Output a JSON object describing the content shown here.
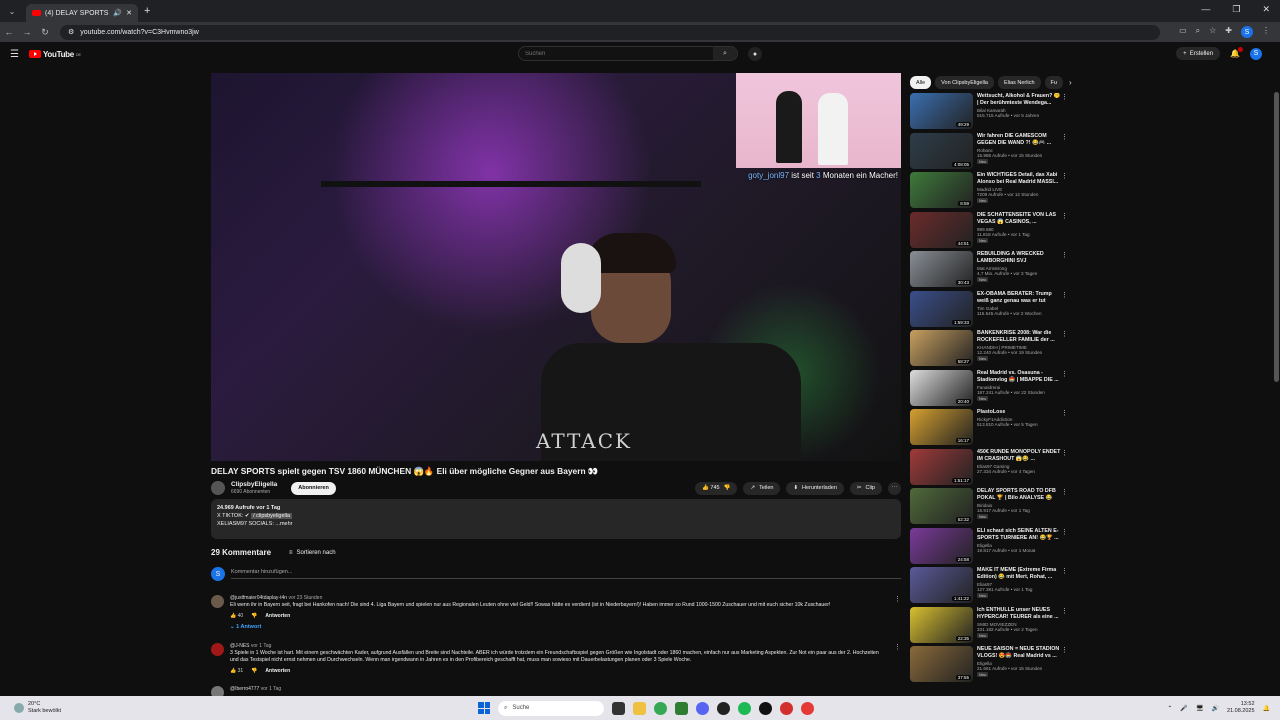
{
  "browser": {
    "tab_title": "(4) DELAY SPORTS spielt ge",
    "url": "youtube.com/watch?v=C3Hvmwno3jw",
    "profile_initial": "S"
  },
  "youtube": {
    "logo_text": "YouTube",
    "logo_country": "DE",
    "search_placeholder": "Suchen",
    "create_label": "Erstellen"
  },
  "video": {
    "pip_username": "goty_jonl97",
    "pip_message_pre": "ist seit",
    "pip_months": "3",
    "pip_message_post": "Monaten ein Macher!",
    "shirt_text": "ATTACK",
    "title": "DELAY SPORTS spielt gegen TSV 1860 MÜNCHEN 😱🔥 Eli über mögliche Gegner aus Bayern 👀",
    "channel_name": "ClipsbyEligella",
    "channel_subs": "6690 Abonnenten",
    "subscribe_label": "Abonnieren",
    "likes": "745",
    "share_label": "Teilen",
    "download_label": "Herunterladen",
    "clip_label": "Clip"
  },
  "description": {
    "stats": "24.969 Aufrufe  vor 1 Tag",
    "line1_prefix": "X TIKTOK: ✔",
    "line1_handle": "/ clipsbyeligella",
    "line2": "XELIASM97 SOCIALS:  ...mehr"
  },
  "comments": {
    "count": "29 Kommentare",
    "sort_label": "Sortieren nach",
    "add_placeholder": "Kommentar hinzufügen...",
    "user_initial": "S",
    "items": [
      {
        "author": "@justfmaier04tdaplay-t4n",
        "time": "vor 23 Stunden",
        "text": "Eli wenn ihr in Bayern seit, fragt bei Hankofen nach! Die sind 4. Liga Bayern und spielen nur aus Regionalen Leuten ohne viel Geld!! Sowas hätte es verdient (ist in Niederbayern!)! Haben immer so Rund 1000-1500 Zuschauer und mit euch sicher 10k Zuschauer!",
        "likes": "40",
        "reply_label": "Antworten",
        "replies": "1 Antwort"
      },
      {
        "author": "@J-NES",
        "time": "vor 1 Tag",
        "text": "3 Spiele in 1 Woche ist hart. Mit einem geschwächten Kader, aufgrund Ausfällen und Breite sind Nachteile. ABER ich würde trotzdem ein Freundschaftsspiel gegen Größen wie Ingolstadt oder 1860 machen, einfach nur aus Marketing Aspekten. Zur Not ein paar aus der 2. Hochzeiten und das Testspiel nicht ernst nehmen und Durchwechseln. Wenn man irgendwann in Jahren es in den Profibereich geschafft hat, muss man sowieso mit Dauerbelastungen planen oder 3 Spiele Woche.",
        "likes": "31",
        "reply_label": "Antworten"
      },
      {
        "author": "@Iberro4777",
        "time": "vor 1 Tag"
      }
    ]
  },
  "sidebar": {
    "chips": [
      "Alle",
      "Von ClipsbyEligella",
      "Elias Nerlich",
      "Fu"
    ],
    "recommendations": [
      {
        "title": "Wettsucht, Alkohol & Frauen? 🤫 | Der berühmteste Wendega...",
        "channel": "Bilal Kamarah",
        "meta": "515.715 Aufrufe • vor 5 Jahren",
        "duration": "49:29",
        "color": "#3a6fb0"
      },
      {
        "title": "Wir fahren DIE GAMESCOM GEGEN DIE WAND ?! 😂🎮 ...",
        "channel": "Rohanc",
        "meta": "15.986 Aufrufe • vor 15 Stunden",
        "duration": "4:08:05",
        "color": "#2d3d4a",
        "new": "Neu"
      },
      {
        "title": "Ein WICHTIGES Detail, das Xabi Alonso bei Real Madrid MASSI...",
        "channel": "Madrid LIVE",
        "meta": "7209 Aufrufe • vor 12 Stunden",
        "duration": "8:59",
        "color": "#3e7a3a",
        "new": "Neu"
      },
      {
        "title": "DIE SCHATTENSEITE VON LAS VEGAS 😱 CASINOS, ...",
        "channel": "999.580",
        "meta": "11.818 Aufrufe • vor 1 Tag",
        "duration": "44:51",
        "color": "#6b2b2b",
        "new": "Neu"
      },
      {
        "title": "REBUILDING A WRECKED LAMBORGHINI SVJ",
        "channel": "Mat Armstrong",
        "meta": "4,7 Mio. Aufrufe • vor 3 Tagen",
        "duration": "30:43",
        "color": "#8a8f96",
        "new": "Neu"
      },
      {
        "title": "EX-OBAMA BERATER: Trump weiß ganz genau was er tut",
        "channel": "Tim Gabel",
        "meta": "115.545 Aufrufe • vor 2 Wochen",
        "duration": "1:59:33",
        "color": "#3a4f8a"
      },
      {
        "title": "BANKENKRISE 2008: War die ROCKEFELLER FAMILIE der ...",
        "channel": "KHANDIH | PRIMETIME",
        "meta": "12.240 Aufrufe • vor 19 Stunden",
        "duration": "58:27",
        "color": "#c8a060",
        "new": "Neu"
      },
      {
        "title": "Real Madrid vs. Osasuna - Stadionvlog 🏟️ | MBAPPE DIE ...",
        "channel": "Fanaldrerai",
        "meta": "187.241 Aufrufe • vor 22 Stunden",
        "duration": "20:40",
        "color": "#ddd",
        "new": "Neu"
      },
      {
        "title": "PlastoLose",
        "channel": "RickyF1Addiction",
        "meta": "513.810 Aufrufe • vor 5 Tagen",
        "duration": "16:17",
        "color": "#d6a030"
      },
      {
        "title": "450€ RUNDE MONOPOLY ENDET IM CRASHOUT 😱😂 ...",
        "channel": "Elias97 Gaming",
        "meta": "27.334 Aufrufe • vor 4 Tagen",
        "duration": "1:51:17",
        "color": "#a03a3a"
      },
      {
        "title": "DELAY SPORTS ROAD TO DFB POKAL 🏆 | Bilo ANALYSE 😂",
        "channel": "Biridaio",
        "meta": "16.917 Aufrufe • vor 1 Tag",
        "duration": "52:32",
        "color": "#4f6a3a",
        "new": "Neu"
      },
      {
        "title": "ELI schaut sich SEINE ALTEN E-SPORTS TURNIERE AN! 😂🏆 ...",
        "channel": "Eligella",
        "meta": "19.817 Aufrufe • vor 1 Monat",
        "duration": "24:58",
        "color": "#7a3a9a"
      },
      {
        "title": "MAKE IT MEME (Extreme Firma Edition) 😂 mit Mert, Rohat, ...",
        "channel": "Elias97",
        "meta": "127.381 Aufrufe • vor 1 Tag",
        "duration": "1:41:22",
        "color": "#5a5a9a",
        "new": "Neu"
      },
      {
        "title": "Ich ENTHÜLLE unser NEUES HYPERCAR! TEURER als eine ...",
        "channel": "SMID MOVIEZZEN",
        "meta": "331.182 Aufrufe • vor 2 Tagen",
        "duration": "22:35",
        "color": "#d8c030",
        "new": "Neu"
      },
      {
        "title": "NEUE SAISON = NEUE STADION VLOGS! 😍🏟️ Real Madrid vs ...",
        "channel": "Eligella",
        "meta": "21.661 Aufrufe • vor 15 Stunden",
        "duration": "37:55",
        "color": "#8a6a3a",
        "new": "Neu"
      }
    ]
  },
  "taskbar": {
    "weather_temp": "20°C",
    "weather_desc": "Stark bewölkt",
    "search_label": "Suche",
    "time": "13:52",
    "date": "21.08.2025"
  }
}
